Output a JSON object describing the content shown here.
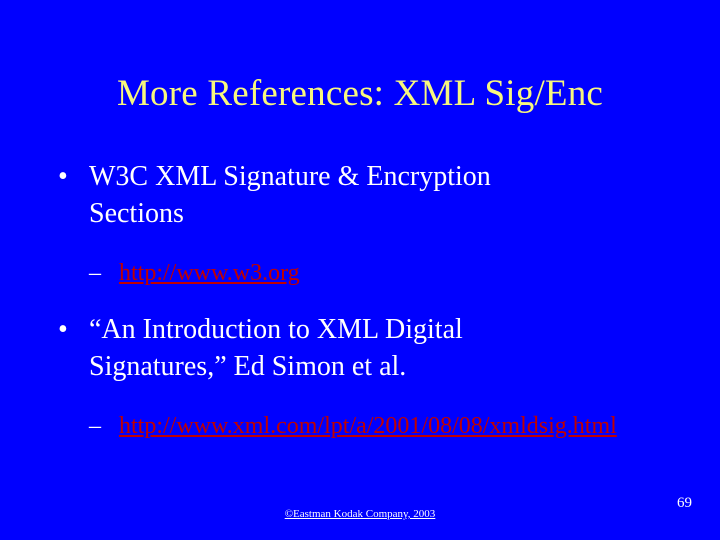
{
  "slide": {
    "background_color": "#0000FF",
    "title": "More References: XML Sig/Enc",
    "title_color": "#F7F77E",
    "body_text_color": "#FFFFFF",
    "link_color": "#C00000",
    "bullets": [
      {
        "level": 1,
        "marker": "•",
        "text": "W3C XML Signature & Encryption Sections"
      },
      {
        "level": 2,
        "marker": "–",
        "text": "http://www.w3.org",
        "is_link": true
      },
      {
        "level": 1,
        "marker": "•",
        "text": "“An Introduction to XML Digital Signatures,” Ed Simon et al."
      },
      {
        "level": 2,
        "marker": "–",
        "text": "http://www.xml.com/lpt/a/2001/08/08/xmldsig.html",
        "is_link": true
      }
    ],
    "footer": {
      "copyright": "©Eastman Kodak Company, 2003",
      "page_number": "69"
    }
  }
}
